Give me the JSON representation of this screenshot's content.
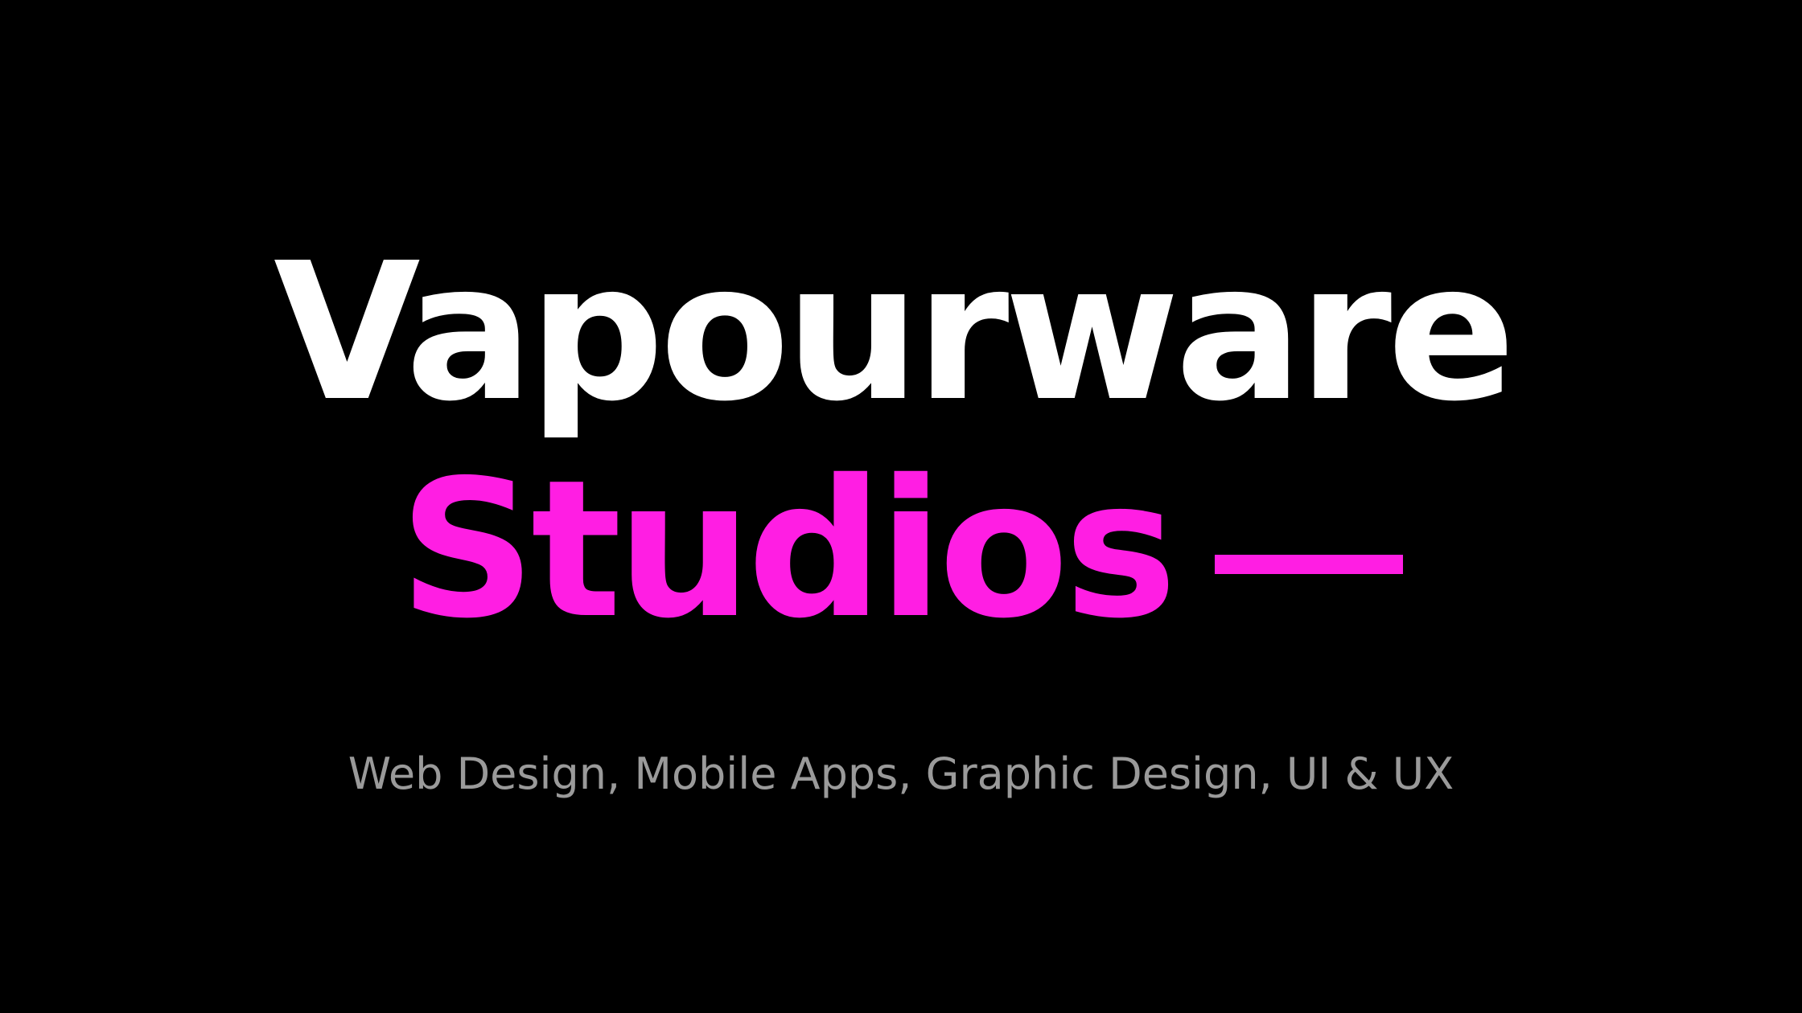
{
  "headline": {
    "line1": "Vapourware",
    "line2": "Studios"
  },
  "tagline": "Web Design, Mobile Apps, Graphic Design, UI & UX",
  "colors": {
    "background": "#000000",
    "headline_primary": "#ffffff",
    "accent": "#ff1ee3",
    "tagline": "#9a9a9a"
  },
  "icons": {
    "dash": "em-dash-bar"
  }
}
